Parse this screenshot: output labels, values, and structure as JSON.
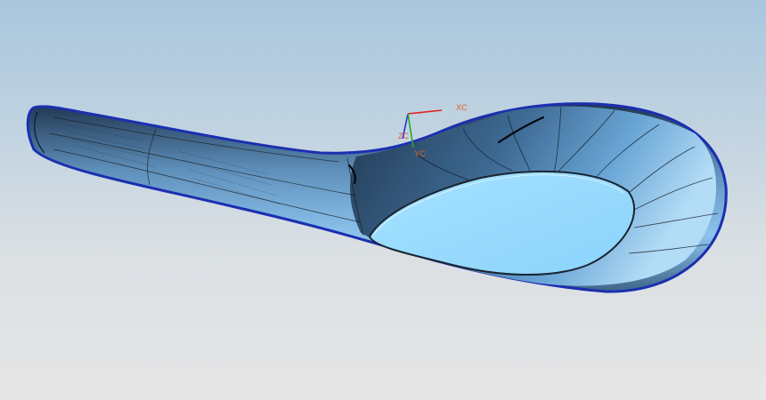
{
  "viewport": {
    "background_top": "#a9c6dd",
    "background_bottom": "#e6e6e6"
  },
  "model": {
    "name": "spoon-surface-model",
    "edge_color": "#1b2fb0",
    "face_light": "#8fc7ef",
    "face_dark": "#2d4a66",
    "bowl_opening_color": "#9adcff"
  },
  "triad": {
    "x_label": "XC",
    "y_label": "YC",
    "z_label": "ZC",
    "x_color": "#e02020",
    "y_color": "#20b020",
    "z_color": "#2030e0"
  }
}
